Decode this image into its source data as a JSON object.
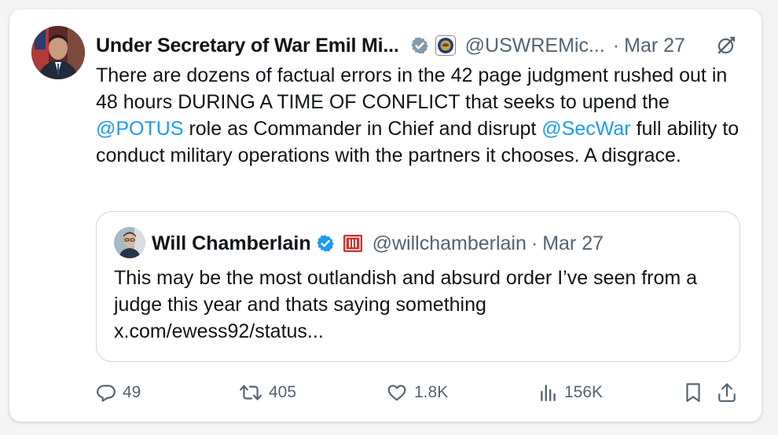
{
  "tweet": {
    "author_name": "Under Secretary of War Emil Mi...",
    "handle": "@USWREMic...",
    "separator": "·",
    "date": "Mar 27",
    "text_parts": {
      "p1": "There are dozens of factual errors in the 42 page judgment rushed out in 48 hours DURING A TIME OF CONFLICT that seeks to upend the ",
      "mention1": "@POTUS",
      "p2": " role as Commander in Chief and disrupt ",
      "mention2": "@SecWar",
      "p3": " full ability to conduct military operations with the partners it chooses.  A disgrace."
    }
  },
  "quoted_tweet": {
    "author_name": "Will Chamberlain",
    "handle": "@willchamberlain",
    "separator": "·",
    "date": "Mar 27",
    "text": "This may be the most outlandish and absurd order I’ve seen from a judge this year and thats saying something",
    "link": "x.com/ewess92/status..."
  },
  "actions": {
    "replies": "49",
    "reposts": "405",
    "likes": "1.8K",
    "views": "156K"
  },
  "icons": {
    "header": [
      "verified-gray-badge-icon",
      "department-seal-icon",
      "grok-icon"
    ],
    "quote": [
      "verified-blue-badge-icon",
      "flag-icon"
    ],
    "actions": [
      "reply-icon",
      "repost-icon",
      "like-icon",
      "views-icon",
      "bookmark-icon",
      "share-icon"
    ]
  },
  "colors": {
    "accent": "#1d9bf0",
    "secondary_text": "#536471",
    "primary_text": "#0f1419",
    "gray_badge": "#829aab",
    "flag_red": "#c8342d"
  }
}
